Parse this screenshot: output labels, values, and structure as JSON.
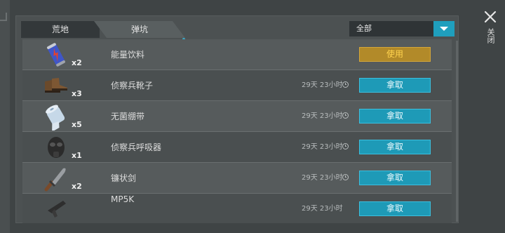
{
  "tabs": [
    "荒地",
    "弹坑"
  ],
  "filter": {
    "selected": "全部"
  },
  "items": [
    {
      "name": "能量饮料",
      "qty": "x2",
      "time": "",
      "action": "使用",
      "icon": "energy-drink-can-icon"
    },
    {
      "name": "侦察兵靴子",
      "qty": "x3",
      "time": "29天 23小时",
      "action": "拿取",
      "icon": "scout-boots-icon"
    },
    {
      "name": "无菌绷带",
      "qty": "x5",
      "time": "29天 23小时",
      "action": "拿取",
      "icon": "sterile-bandage-icon"
    },
    {
      "name": "侦察兵呼吸器",
      "qty": "x1",
      "time": "29天 23小时",
      "action": "拿取",
      "icon": "scout-respirator-icon"
    },
    {
      "name": "镰状剑",
      "qty": "x2",
      "time": "29天 23小时",
      "action": "拿取",
      "icon": "sickle-sword-icon"
    },
    {
      "name": "MP5K",
      "qty": "",
      "time": "29天 23小时",
      "action": "拿取",
      "icon": "smg-icon"
    }
  ],
  "close_label": "关闭",
  "colors": {
    "take_button": "#1e9ab7",
    "use_button": "#b28a29",
    "accent": "#1f9fbd"
  }
}
